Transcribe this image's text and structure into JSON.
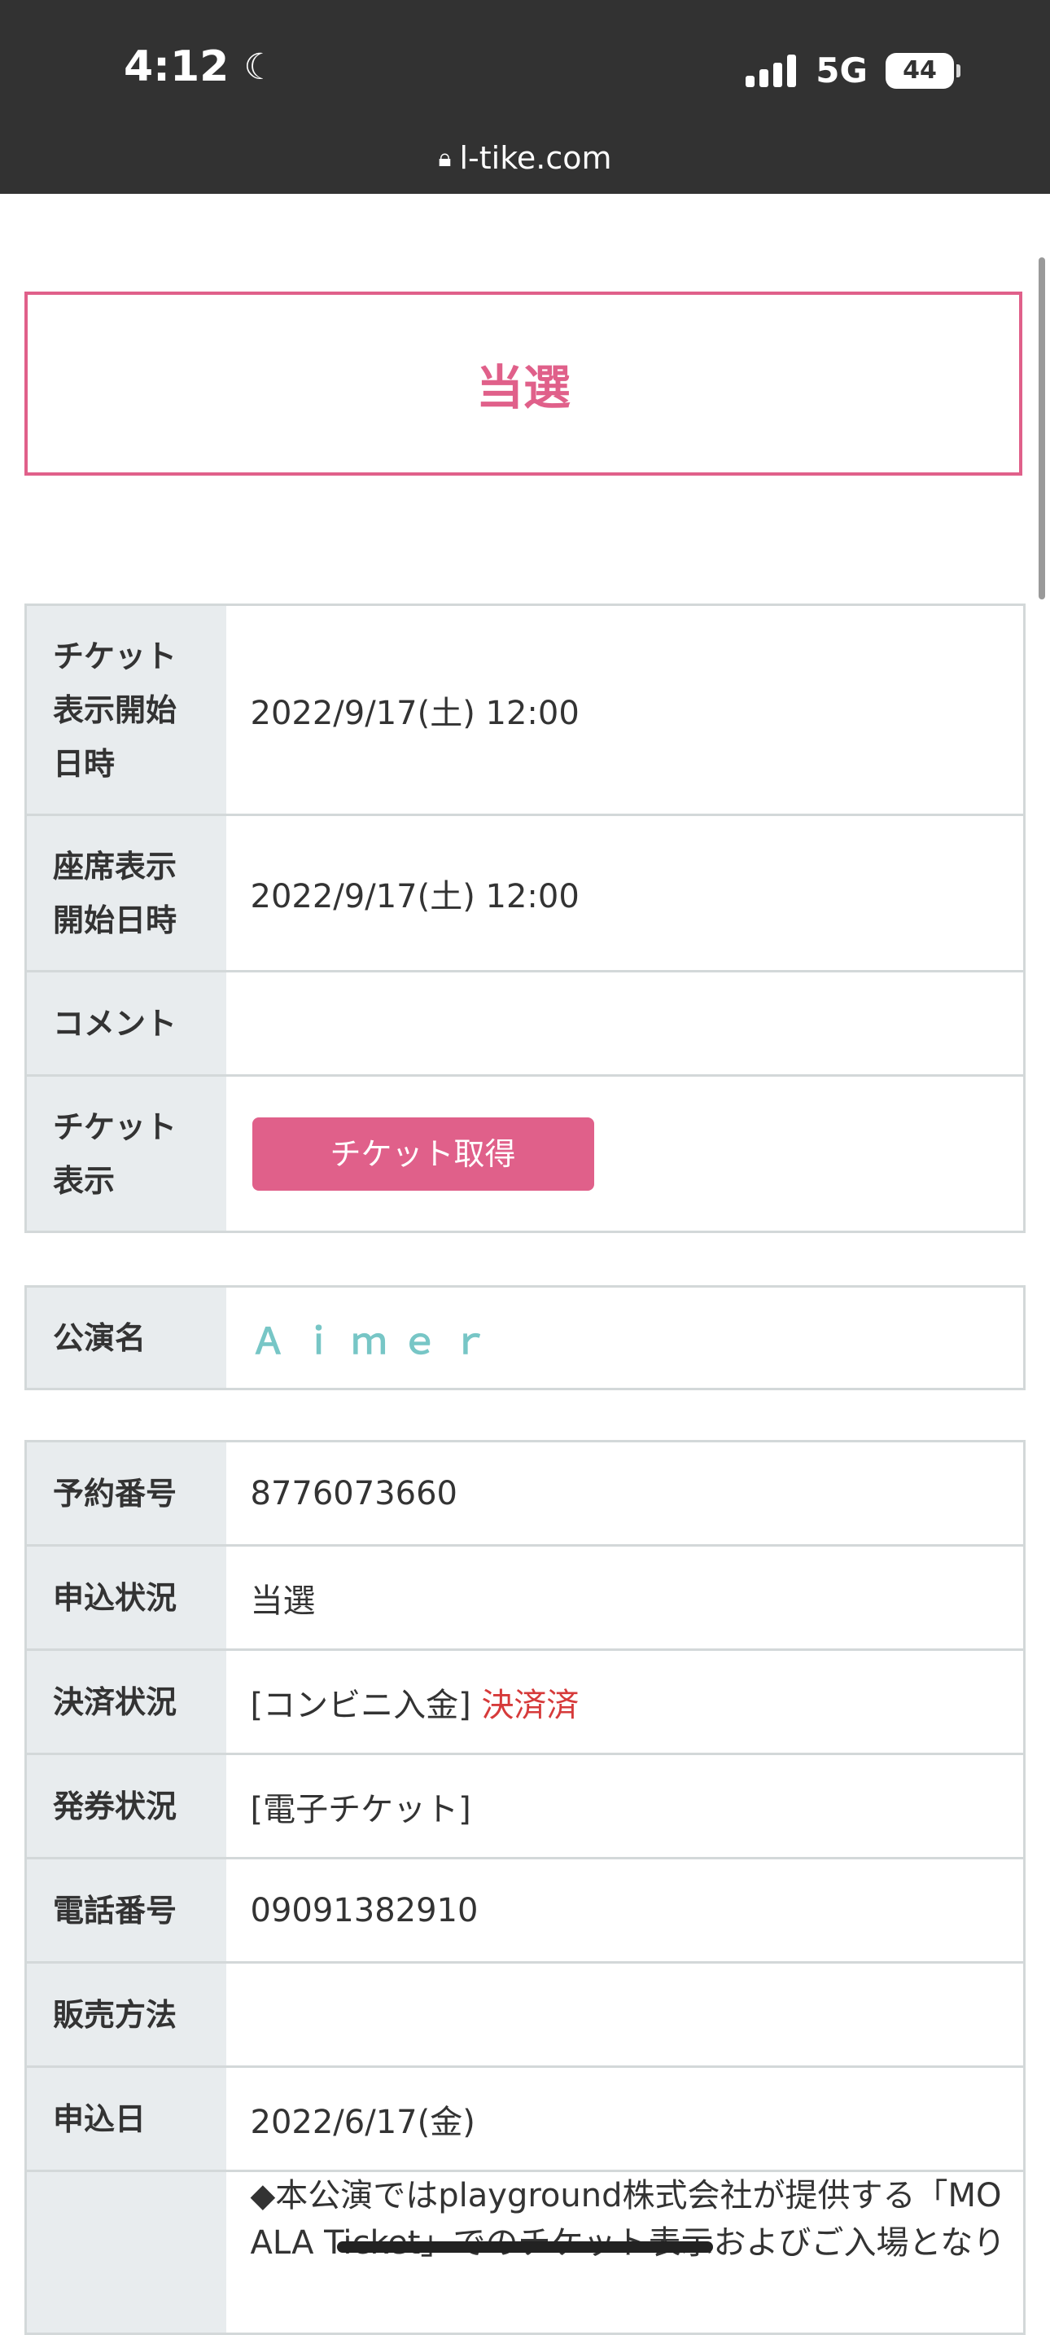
{
  "status_bar": {
    "time": "4:12",
    "network": "5G",
    "battery": "44",
    "url": "l-tike.com"
  },
  "result": {
    "label": "当選"
  },
  "ticket_table": {
    "rows": [
      {
        "label_lines": [
          "チケット",
          "表示開始",
          "日時"
        ],
        "value": "2022/9/17(土) 12:00"
      },
      {
        "label_lines": [
          "座席表示",
          "開始日時"
        ],
        "value": "2022/9/17(土) 12:00"
      },
      {
        "label_lines": [
          "コメント"
        ],
        "value": ""
      },
      {
        "label_lines": [
          "チケット",
          "表示"
        ],
        "button": "チケット取得"
      }
    ]
  },
  "performance": {
    "label": "公演名",
    "value": "Ａｉｍｅｒ"
  },
  "order_table": {
    "rows": [
      {
        "label": "予約番号",
        "value": "8776073660"
      },
      {
        "label": "申込状況",
        "value": "当選"
      },
      {
        "label": "決済状況",
        "value": "[コンビニ入金]",
        "status": "決済済"
      },
      {
        "label": "発券状況",
        "value": "[電子チケット]"
      },
      {
        "label": "電話番号",
        "value": "09091382910"
      },
      {
        "label": "販売方法",
        "value": ""
      },
      {
        "label": "申込日",
        "value": "2022/6/17(金)"
      }
    ],
    "notice_line1": "◆本公演ではplayground株式会社が提供する「MO",
    "notice_line2": "ALA Ticket」でのチケット表示およびご入場となり"
  },
  "colors": {
    "accent_pink": "#e0608a",
    "artist_teal": "#77c6c6",
    "paid_red": "#d63a3a"
  }
}
